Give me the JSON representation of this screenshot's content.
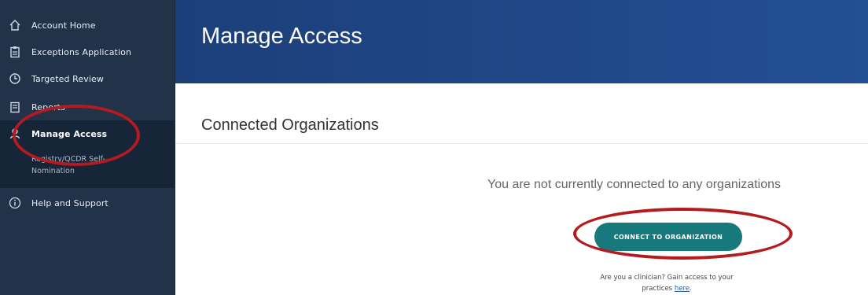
{
  "sidebar": {
    "items": [
      {
        "label": "Account Home",
        "icon": "home-icon"
      },
      {
        "label": "Exceptions Application",
        "icon": "clipboard-icon"
      },
      {
        "label": "Targeted Review",
        "icon": "review-icon"
      },
      {
        "label": "Reports",
        "icon": "report-icon"
      },
      {
        "label": "Manage Access",
        "icon": "access-icon"
      },
      {
        "label": "Help and Support",
        "icon": "info-icon"
      }
    ],
    "sub_item": "Registry/QCDR Self-Nomination"
  },
  "header": {
    "title": "Manage Access"
  },
  "main": {
    "section_title": "Connected Organizations",
    "empty_message": "You are not currently connected to any organizations",
    "connect_button": "CONNECT TO ORGANIZATION",
    "clinician_text": "Are you a clinician? Gain access to your practices",
    "clinician_link": "here",
    "clinician_end": "."
  },
  "colors": {
    "sidebar_bg": "#223349",
    "header_bg": "#234f93",
    "button_bg": "#18797c",
    "annotation": "#b31b1f"
  }
}
